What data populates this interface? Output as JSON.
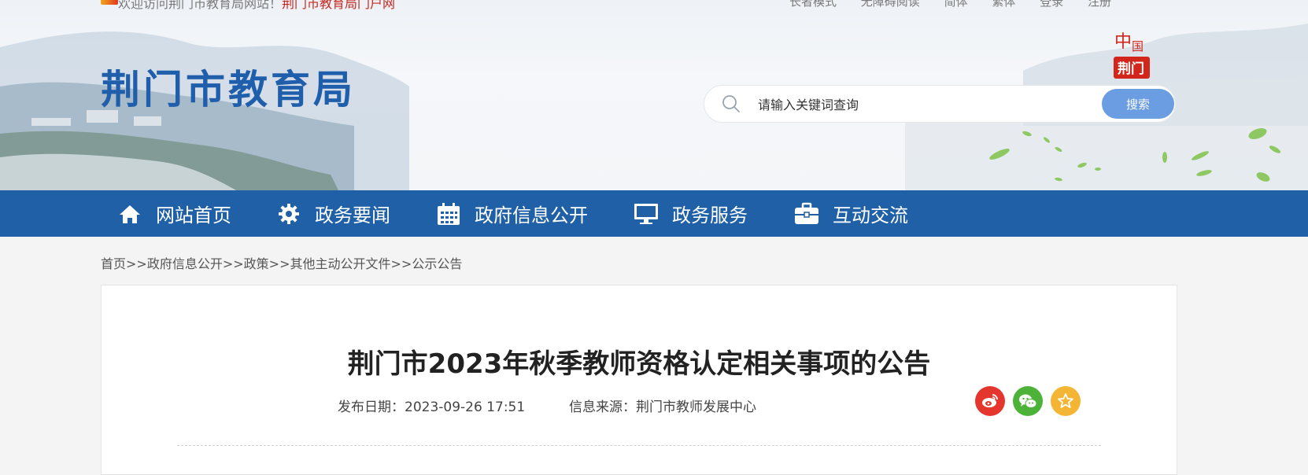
{
  "header": {
    "notice_prefix": "欢迎访问荆门市教育局网站！",
    "notice_highlight": "荆门市教育局门户网",
    "top_links": [
      "长者模式",
      "无障碍阅读",
      "简体",
      "繁体",
      "登录",
      "注册"
    ],
    "site_title": "荆门市教育局",
    "seal_top": "中国",
    "seal_bottom": "荆门"
  },
  "search": {
    "placeholder": "请输入关键词查询",
    "button_label": "搜索"
  },
  "nav": {
    "items": [
      {
        "label": "网站首页",
        "icon": "home-icon"
      },
      {
        "label": "政务要闻",
        "icon": "gear-icon"
      },
      {
        "label": "政府信息公开",
        "icon": "calendar-icon"
      },
      {
        "label": "政务服务",
        "icon": "monitor-icon"
      },
      {
        "label": "互动交流",
        "icon": "briefcase-icon"
      }
    ]
  },
  "breadcrumb": {
    "items": [
      "首页",
      "政府信息公开",
      "政策",
      "其他主动公开文件",
      "公示公告"
    ],
    "separator": ">>"
  },
  "article": {
    "title": "荆门市2023年秋季教师资格认定相关事项的公告",
    "date_label": "发布日期：",
    "date_value": "2023-09-26 17:51",
    "source_label": "信息来源：",
    "source_value": "荆门市教师发展中心"
  },
  "share": {
    "icons": [
      "weibo-icon",
      "wechat-icon",
      "favorite-icon"
    ]
  },
  "colors": {
    "nav_bg": "#2060a6",
    "title_blue": "#1f5eaa",
    "search_button": "#6a9de2",
    "weibo": "#e4362c",
    "wechat": "#4cb338",
    "favorite": "#f4b534"
  }
}
